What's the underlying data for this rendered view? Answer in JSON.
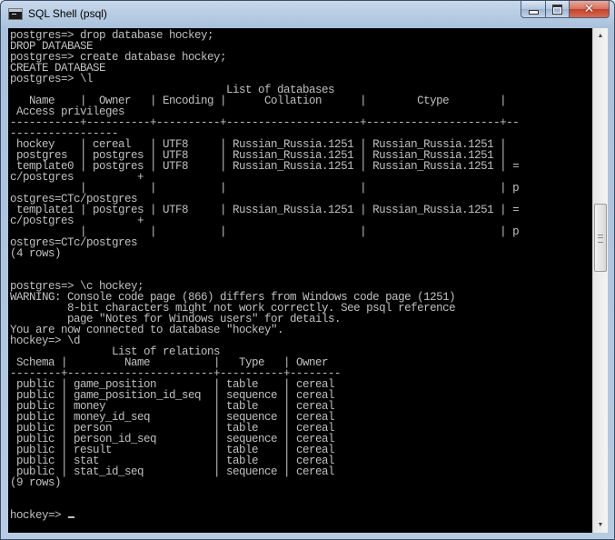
{
  "window": {
    "title": "SQL Shell (psql)",
    "icons": {
      "app": "console-icon",
      "minimize": "minimize-icon",
      "maximize": "maximize-icon",
      "close": "close-icon"
    }
  },
  "console": {
    "lines": [
      "postgres=> drop database hockey;",
      "DROP DATABASE",
      "postgres=> create database hockey;",
      "CREATE DATABASE",
      "postgres=> \\l",
      "                                  List of databases",
      "   Name    |  Owner   | Encoding |      Collation      |        Ctype        |",
      " Access privileges",
      "-----------+----------+----------+---------------------+---------------------+--",
      "-----------------",
      " hockey    | cereal   | UTF8     | Russian_Russia.1251 | Russian_Russia.1251 |",
      " postgres  | postgres | UTF8     | Russian_Russia.1251 | Russian_Russia.1251 |",
      " template0 | postgres | UTF8     | Russian_Russia.1251 | Russian_Russia.1251 | =",
      "c/postgres          +",
      "           |          |          |                     |                     | p",
      "ostgres=CTc/postgres",
      " template1 | postgres | UTF8     | Russian_Russia.1251 | Russian_Russia.1251 | =",
      "c/postgres          +",
      "           |          |          |                     |                     | p",
      "ostgres=CTc/postgres",
      "(4 rows)",
      "",
      "",
      "postgres=> \\c hockey;",
      "WARNING: Console code page (866) differs from Windows code page (1251)",
      "         8-bit characters might not work correctly. See psql reference",
      "         page \"Notes for Windows users\" for details.",
      "You are now connected to database \"hockey\".",
      "hockey=> \\d",
      "                List of relations",
      " Schema |         Name          |   Type   | Owner",
      "--------+-----------------------+----------+--------",
      " public | game_position         | table    | cereal",
      " public | game_position_id_seq  | sequence | cereal",
      " public | money                 | table    | cereal",
      " public | money_id_seq          | sequence | cereal",
      " public | person                | table    | cereal",
      " public | person_id_seq         | sequence | cereal",
      " public | result                | table    | cereal",
      " public | stat                  | table    | cereal",
      " public | stat_id_seq           | sequence | cereal",
      "(9 rows)",
      "",
      "",
      "hockey=> "
    ]
  }
}
